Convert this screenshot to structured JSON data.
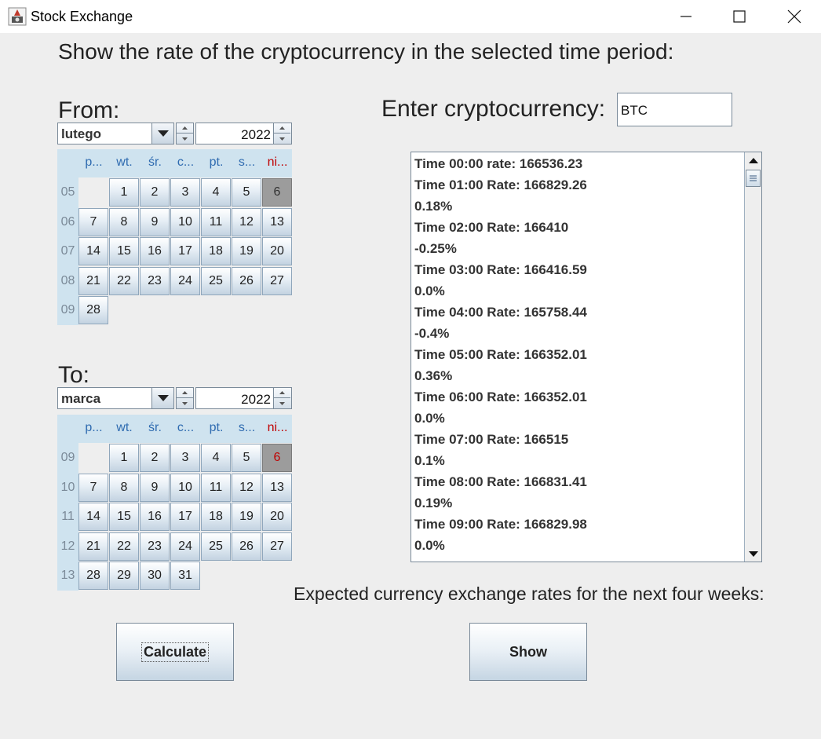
{
  "window": {
    "title": "Stock Exchange",
    "controls": {
      "minimize": "minimize",
      "maximize": "maximize",
      "close": "close"
    }
  },
  "heading": "Show the rate of the cryptocurrency in the selected time period:",
  "from": {
    "label": "From:",
    "month": "lutego",
    "year": "2022",
    "weekdays": [
      "p...",
      "wt.",
      "śr.",
      "c...",
      "pt.",
      "s...",
      "ni..."
    ],
    "weeks": [
      {
        "week": "05",
        "days": [
          "",
          "1",
          "2",
          "3",
          "4",
          "5",
          "6"
        ]
      },
      {
        "week": "06",
        "days": [
          "7",
          "8",
          "9",
          "10",
          "11",
          "12",
          "13"
        ]
      },
      {
        "week": "07",
        "days": [
          "14",
          "15",
          "16",
          "17",
          "18",
          "19",
          "20"
        ]
      },
      {
        "week": "08",
        "days": [
          "21",
          "22",
          "23",
          "24",
          "25",
          "26",
          "27"
        ]
      },
      {
        "week": "09",
        "days": [
          "28",
          "",
          "",
          "",
          "",
          "",
          ""
        ]
      }
    ],
    "selected_day": "6"
  },
  "to": {
    "label": "To:",
    "month": "marca",
    "year": "2022",
    "weekdays": [
      "p...",
      "wt.",
      "śr.",
      "c...",
      "pt.",
      "s...",
      "ni..."
    ],
    "weeks": [
      {
        "week": "09",
        "days": [
          "",
          "1",
          "2",
          "3",
          "4",
          "5",
          "6"
        ]
      },
      {
        "week": "10",
        "days": [
          "7",
          "8",
          "9",
          "10",
          "11",
          "12",
          "13"
        ]
      },
      {
        "week": "11",
        "days": [
          "14",
          "15",
          "16",
          "17",
          "18",
          "19",
          "20"
        ]
      },
      {
        "week": "12",
        "days": [
          "21",
          "22",
          "23",
          "24",
          "25",
          "26",
          "27"
        ]
      },
      {
        "week": "13",
        "days": [
          "28",
          "29",
          "30",
          "31",
          "",
          "",
          ""
        ]
      }
    ],
    "selected_day": "6"
  },
  "crypto": {
    "label": "Enter cryptocurrency:",
    "value": "BTC"
  },
  "rates_list": [
    "Time 00:00 rate: 166536.23",
    "Time 01:00 Rate: 166829.26",
    "0.18%",
    "Time 02:00 Rate: 166410",
    "-0.25%",
    "Time 03:00 Rate: 166416.59",
    "0.0%",
    "Time 04:00 Rate: 165758.44",
    "-0.4%",
    "Time 05:00 Rate: 166352.01",
    "0.36%",
    "Time 06:00 Rate: 166352.01",
    "0.0%",
    "Time 07:00 Rate: 166515",
    "0.1%",
    "Time 08:00 Rate: 166831.41",
    "0.19%",
    "Time 09:00 Rate: 166829.98",
    "0.0%"
  ],
  "expected_label": "Expected currency exchange rates for the next four weeks:",
  "buttons": {
    "calculate": "Calculate",
    "show": "Show"
  },
  "colors": {
    "weekday_text": "#2f6bb0",
    "sunday_text": "#c00000",
    "calendar_bg": "#cfe3ef",
    "selected_day": "#9c9c9c"
  }
}
